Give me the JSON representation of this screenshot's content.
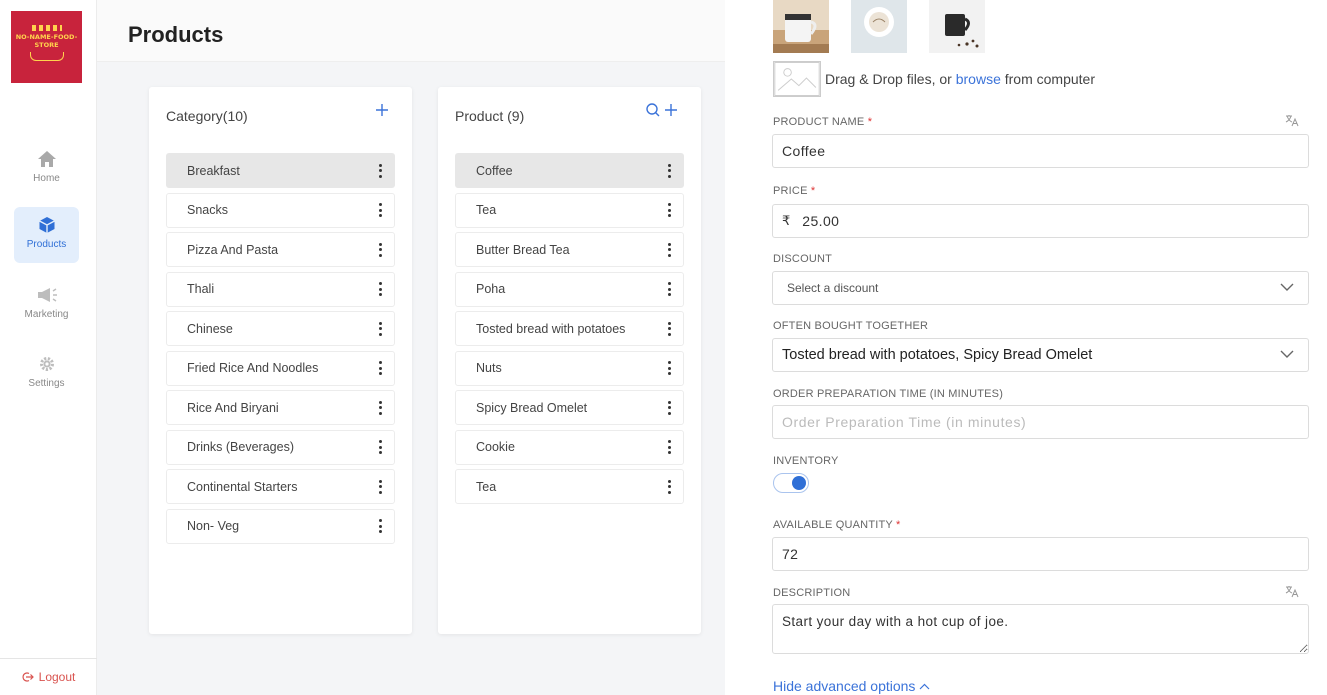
{
  "brand": {
    "logo_text": "NO-NAME-FOOD-STORE",
    "accent": "#2f6fd6",
    "logo_bg": "#c8233c"
  },
  "sidebar": {
    "items": [
      {
        "label": "Home",
        "icon": "home-icon",
        "active": false
      },
      {
        "label": "Products",
        "icon": "box-icon",
        "active": true
      },
      {
        "label": "Marketing",
        "icon": "megaphone-icon",
        "active": false
      },
      {
        "label": "Settings",
        "icon": "gear-icon",
        "active": false
      }
    ],
    "logout_label": "Logout"
  },
  "header": {
    "title": "Products"
  },
  "categories": {
    "title": "Category(10)",
    "items": [
      "Breakfast",
      "Snacks",
      "Pizza And Pasta",
      "Thali",
      "Chinese",
      "Fried Rice And Noodles",
      "Rice And Biryani",
      "Drinks (Beverages)",
      "Continental Starters",
      "Non- Veg"
    ],
    "selected": "Breakfast"
  },
  "products": {
    "title": "Product (9)",
    "items": [
      "Coffee",
      "Tea",
      "Butter Bread Tea",
      "Poha",
      "Tosted bread with potatoes",
      "Nuts",
      "Spicy Bread Omelet",
      "Cookie",
      "Tea"
    ],
    "selected": "Coffee"
  },
  "form": {
    "dropzone": {
      "prefix": "Drag & Drop files, or",
      "link": "browse",
      "suffix": "from computer"
    },
    "product_name": {
      "label": "PRODUCT NAME",
      "value": "Coffee"
    },
    "price": {
      "label": "PRICE",
      "currency": "₹",
      "value": "25.00"
    },
    "discount": {
      "label": "DISCOUNT",
      "placeholder": "Select a discount"
    },
    "often_bought": {
      "label": "OFTEN BOUGHT TOGETHER",
      "value": "Tosted bread with potatoes, Spicy Bread Omelet"
    },
    "prep_time": {
      "label": "ORDER PREPARATION TIME (IN MINUTES)",
      "placeholder": "Order Preparation Time (in minutes)"
    },
    "inventory": {
      "label": "INVENTORY",
      "enabled": true
    },
    "available_qty": {
      "label": "AVAILABLE QUANTITY",
      "value": "72"
    },
    "description": {
      "label": "DESCRIPTION",
      "value": "Start your day with a hot cup of joe."
    },
    "advanced_label": "Hide advanced options"
  }
}
